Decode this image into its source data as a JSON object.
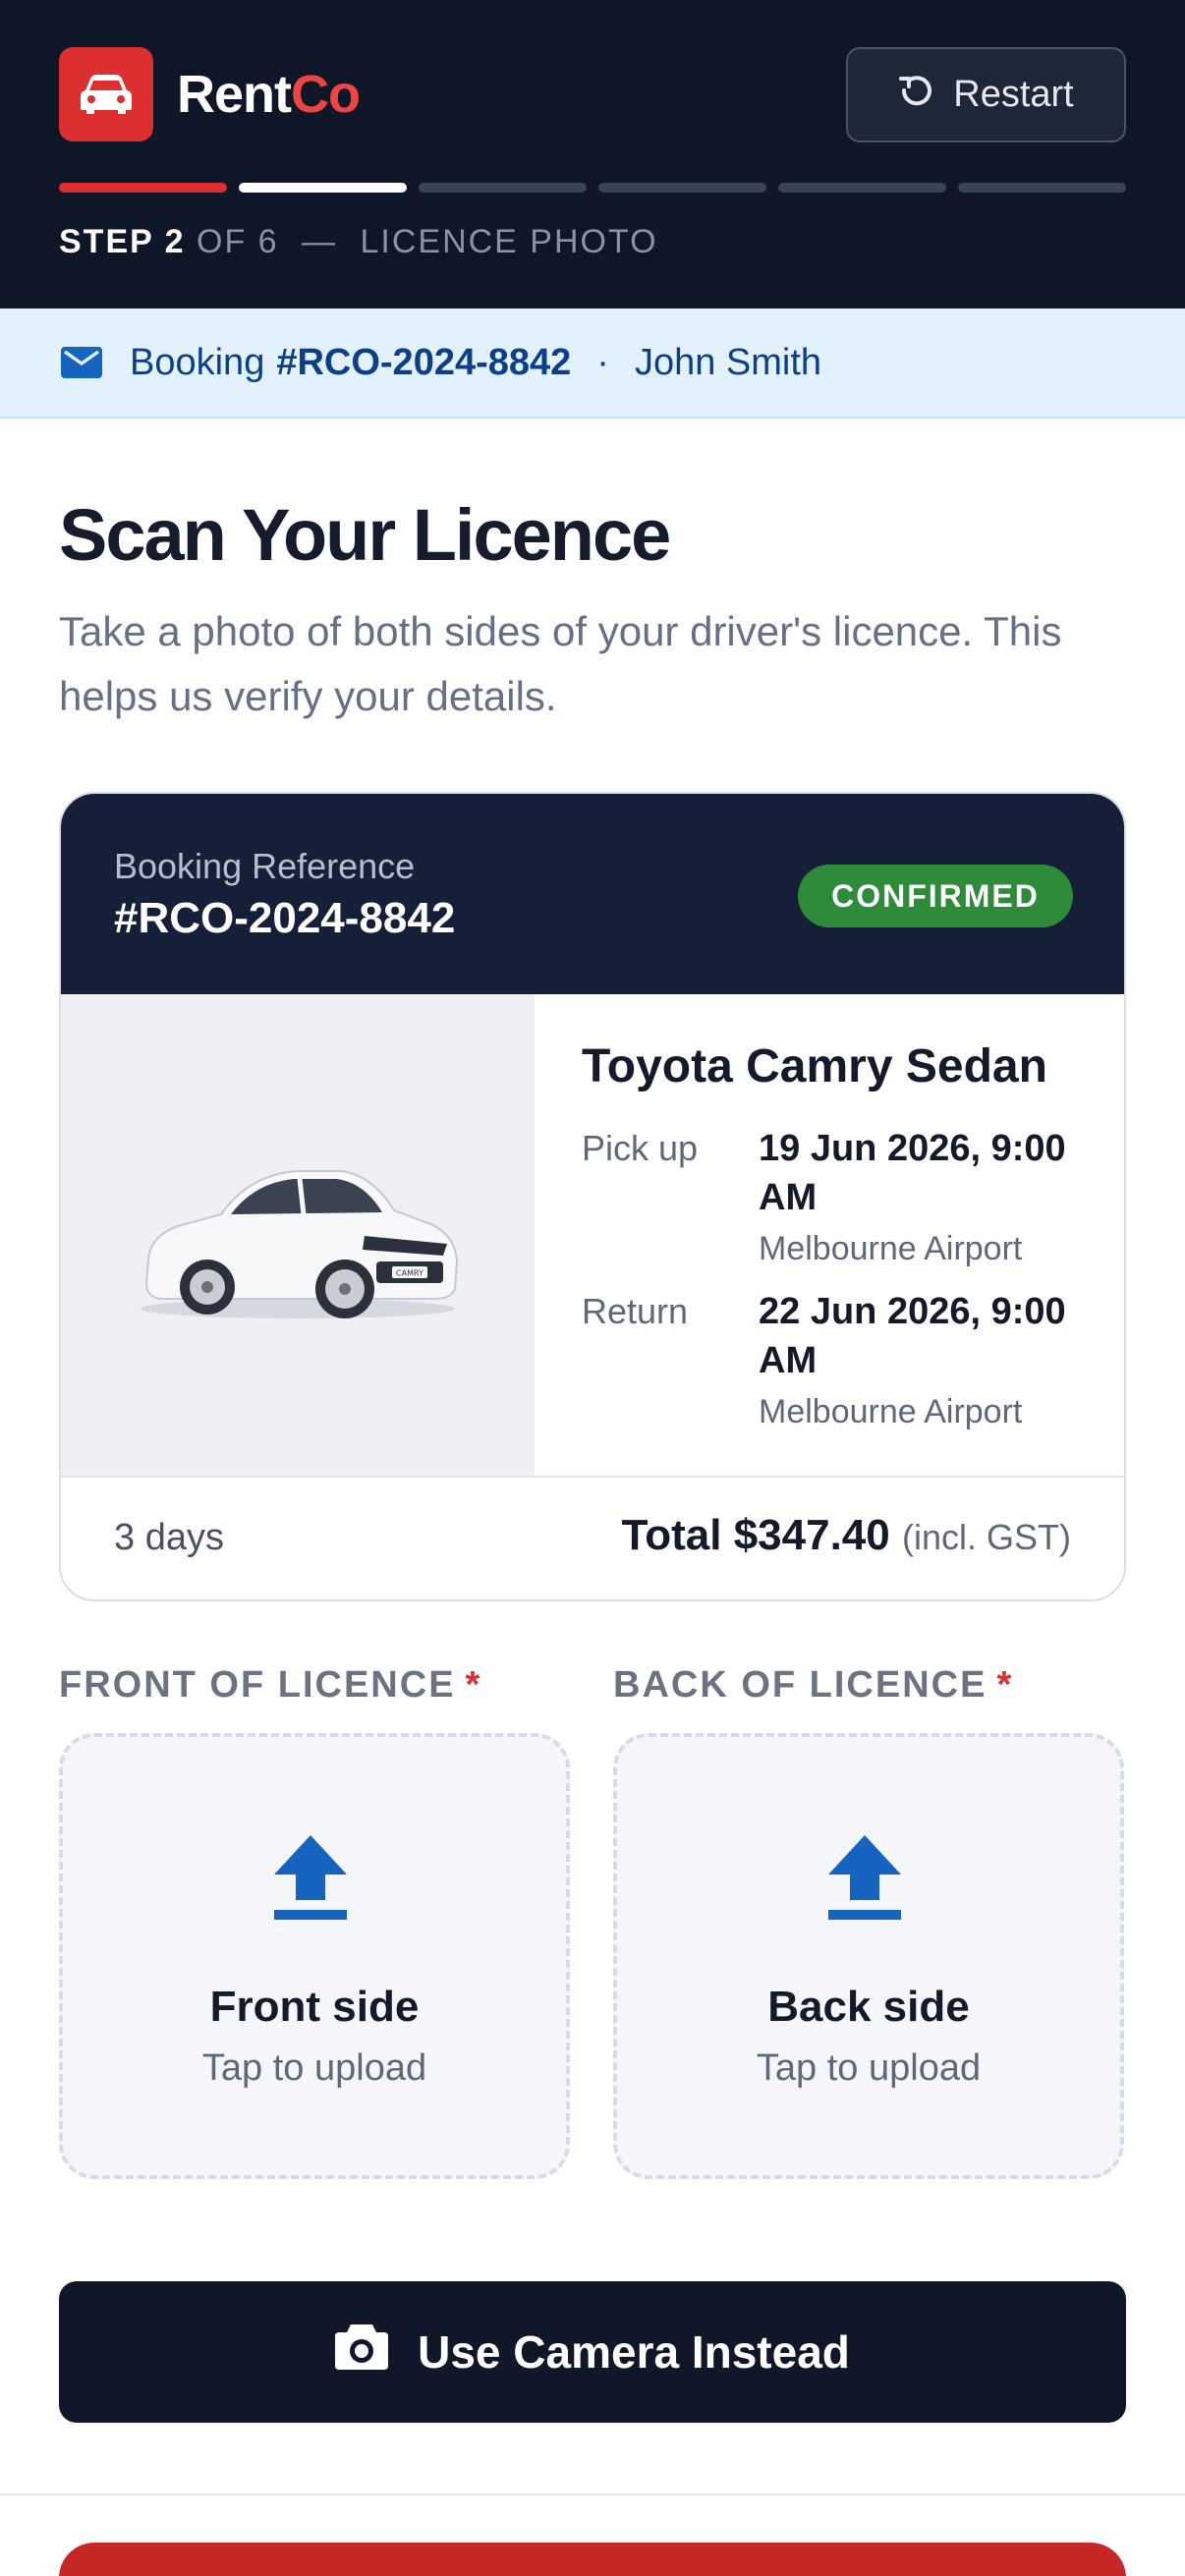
{
  "brand": {
    "name_part1": "Rent",
    "name_part2": "Co"
  },
  "header": {
    "restart_label": "Restart",
    "step": {
      "current_label": "STEP 2",
      "of_label": "OF 6",
      "separator": "—",
      "name": "LICENCE PHOTO"
    },
    "progress": {
      "current_step": 2,
      "total_steps": 6
    }
  },
  "banner": {
    "prefix": "Booking",
    "reference": "#RCO-2024-8842",
    "separator": "·",
    "customer": "John Smith"
  },
  "page": {
    "title": "Scan Your Licence",
    "subtitle": "Take a photo of both sides of your driver's licence. This helps us verify your details."
  },
  "booking_card": {
    "ref_label": "Booking Reference",
    "ref_value": "#RCO-2024-8842",
    "status": "CONFIRMED",
    "car_name": "Toyota Camry Sedan",
    "pickup": {
      "label": "Pick up",
      "datetime": "19 Jun 2026, 9:00 AM",
      "location": "Melbourne Airport"
    },
    "return": {
      "label": "Return",
      "datetime": "22 Jun 2026, 9:00 AM",
      "location": "Melbourne Airport"
    },
    "duration": "3 days",
    "total_label": "Total",
    "total_amount": "$347.40",
    "tax_note": "(incl. GST)",
    "car_plate_text": "CAMRY"
  },
  "upload": {
    "required_mark": "*",
    "front": {
      "label": "FRONT OF LICENCE",
      "title": "Front side",
      "hint": "Tap to upload"
    },
    "back": {
      "label": "BACK OF LICENCE",
      "title": "Back side",
      "hint": "Tap to upload"
    }
  },
  "actions": {
    "camera_label": "Use Camera Instead"
  },
  "colors": {
    "header_bg": "#0e1628",
    "brand_red": "#dc2f2f",
    "banner_bg": "#e3f1fc",
    "status_green": "#2e8b3a",
    "upload_icon_blue": "#1565c0"
  },
  "icons": {
    "logo": "car-icon",
    "restart": "restart-icon",
    "banner": "mail-icon",
    "upload": "upload-icon",
    "camera": "camera-icon"
  }
}
